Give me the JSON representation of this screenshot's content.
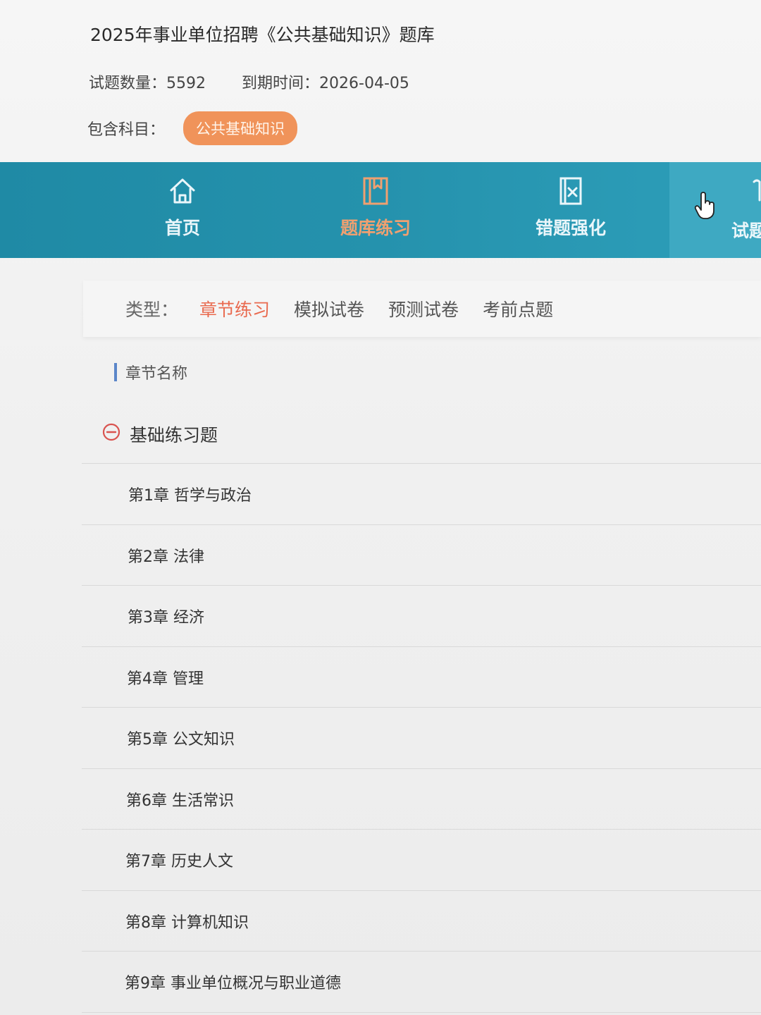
{
  "header": {
    "title": "2025年事业单位招聘《公共基础知识》题库",
    "question_count_label": "试题数量：",
    "question_count": "5592",
    "expiry_label": "到期时间：",
    "expiry_date": "2026-04-05",
    "subjects_label": "包含科目：",
    "subject_tag": "公共基础知识"
  },
  "nav": {
    "items": [
      {
        "label": "首页",
        "icon": "home-icon"
      },
      {
        "label": "题库练习",
        "icon": "book-icon",
        "active": true
      },
      {
        "label": "错题强化",
        "icon": "wrong-note-icon"
      },
      {
        "label": "试题",
        "icon": "paper-icon"
      }
    ]
  },
  "filter": {
    "label": "类型：",
    "options": [
      "章节练习",
      "模拟试卷",
      "预测试卷",
      "考前点题"
    ],
    "active_index": 0
  },
  "chapters": {
    "section_title": "章节名称",
    "group_title": "基础练习题",
    "items": [
      "第1章 哲学与政治",
      "第2章 法律",
      "第3章 经济",
      "第4章 管理",
      "第5章 公文知识",
      "第6章 生活常识",
      "第7章 历史人文",
      "第8章 计算机知识",
      "第9章 事业单位概况与职业道德"
    ]
  },
  "colors": {
    "nav_bg": "#2592ad",
    "accent_orange": "#f0935a",
    "active_type": "#e96a4f",
    "section_bar": "#5b86c9"
  }
}
